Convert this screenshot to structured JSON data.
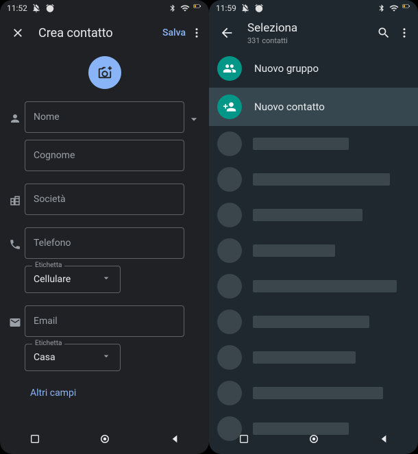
{
  "left": {
    "status": {
      "time": "11:52"
    },
    "appbar": {
      "title": "Crea contatto",
      "save": "Salva"
    },
    "fields": {
      "name_ph": "Nome",
      "surname_ph": "Cognome",
      "company_ph": "Società",
      "phone_ph": "Telefono",
      "phone_label_legend": "Etichetta",
      "phone_label_value": "Cellulare",
      "email_ph": "Email",
      "email_label_legend": "Etichetta",
      "email_label_value": "Casa"
    },
    "more": "Altri campi"
  },
  "right": {
    "status": {
      "time": "11:59"
    },
    "appbar": {
      "title": "Seleziona",
      "subtitle": "331 contatti"
    },
    "actions": {
      "new_group": "Nuovo gruppo",
      "new_contact": "Nuovo contatto"
    },
    "placeholder_rows": [
      140,
      200,
      160,
      120,
      210,
      170,
      150,
      190,
      140
    ]
  }
}
